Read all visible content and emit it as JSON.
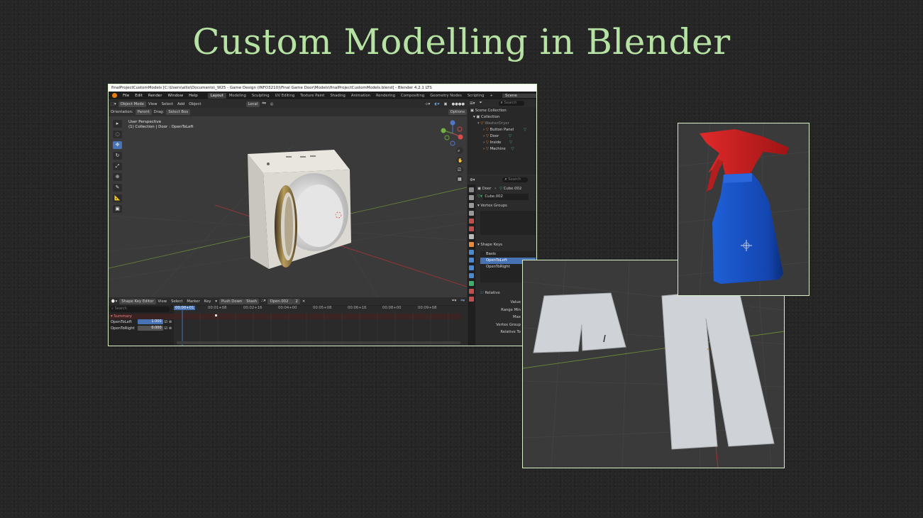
{
  "slide": {
    "title": "Custom Modelling in Blender"
  },
  "window": {
    "title": "finalProjectCustomModels [C:\\Users\\allio\\Documents\\_W25 - Game Design (INFO3210)\\Final Game Door\\Models\\finalProjectCustomModels.blend] - Blender 4.2.1 LTS",
    "menus": [
      "File",
      "Edit",
      "Render",
      "Window",
      "Help"
    ],
    "workspaces": [
      "Layout",
      "Modeling",
      "Sculpting",
      "UV Editing",
      "Texture Paint",
      "Shading",
      "Animation",
      "Rendering",
      "Compositing",
      "Geometry Nodes",
      "Scripting",
      "+"
    ],
    "scene": "Scene"
  },
  "viewport_header": {
    "mode": "Object Mode",
    "menus": [
      "View",
      "Select",
      "Add",
      "Object"
    ],
    "transform": "Local",
    "orientation_label": "Orientation:",
    "orientation_value": "Parent",
    "drag_label": "Drag:",
    "drag_value": "Select Box",
    "options": "Options"
  },
  "viewport": {
    "perspective": "User Perspective",
    "collection_info": "(1) Collection | Door : OpenToLeft",
    "tools": [
      "▸",
      "◌",
      "✥",
      "↻",
      "⤢",
      "⊕",
      "✎",
      "📐",
      "▣"
    ]
  },
  "outliner": {
    "search_placeholder": "Search",
    "root": "Scene Collection",
    "collection": "Collection",
    "parent": "WasherDryer",
    "children": [
      "Button Panel",
      "Door",
      "Inside",
      "Machine"
    ]
  },
  "properties": {
    "search_placeholder": "Search",
    "breadcrumb_object": "Door",
    "breadcrumb_mesh": "Cube.002",
    "mesh_name": "Cube.002",
    "vertex_groups": "Vertex Groups",
    "shape_keys": "Shape Keys",
    "shape_key_list": [
      "Basis",
      "OpenToLeft",
      "OpenToRight"
    ],
    "selected_shape_key": "OpenToLeft",
    "relative": "Relative",
    "fields": [
      "Value",
      "Range Min",
      "Max",
      "Vertex Group",
      "Relative To"
    ]
  },
  "timeline": {
    "editor": "Shape Key Editor",
    "menus": [
      "View",
      "Select",
      "Marker",
      "Key"
    ],
    "push_down": "Push Down",
    "stash": "Stash",
    "action": "Open.002",
    "users": "2",
    "search_placeholder": "Search",
    "current_frame": "00:00+01",
    "ticks": [
      "00:01+08",
      "00:02+16",
      "00:04+00",
      "00:05+08",
      "00:06+16",
      "00:08+00",
      "00:09+08"
    ],
    "summary": "Summary",
    "channels": [
      {
        "name": "OpenToLeft",
        "value": "1.000"
      },
      {
        "name": "OpenToRight",
        "value": "0.000"
      }
    ]
  },
  "colors": {
    "title_green": "#b6e3a3",
    "accent_blue": "#4772b3",
    "blender_orange": "#e87d0d",
    "border": "#d9f0c9"
  }
}
